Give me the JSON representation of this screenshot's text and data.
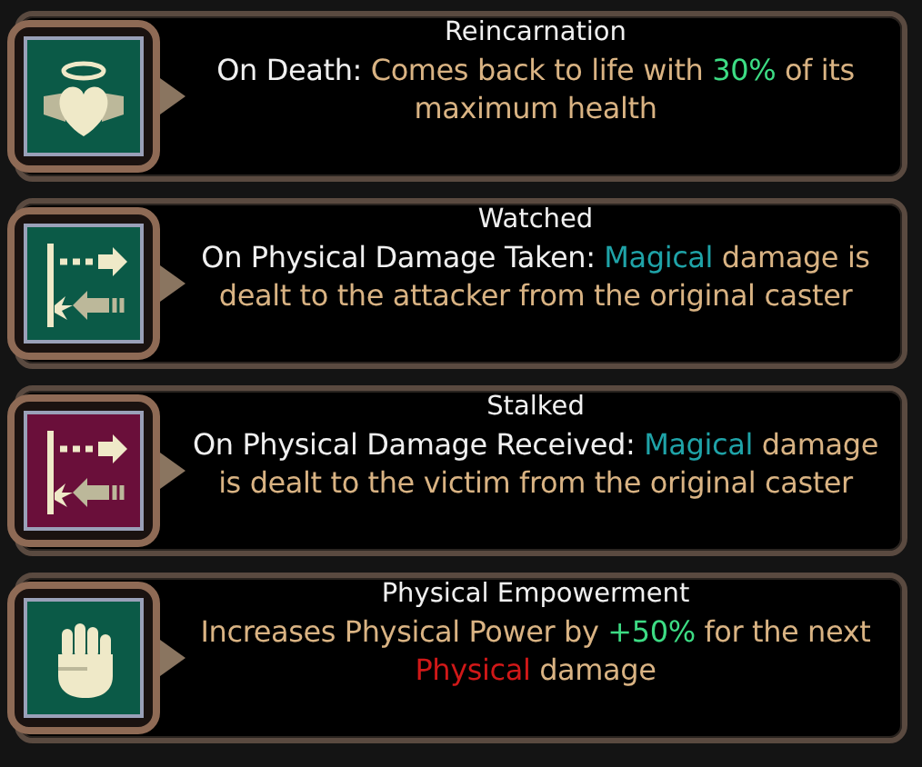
{
  "effects": [
    {
      "title": "Reincarnation",
      "kind": "heart",
      "color": "#0b5a47",
      "description": [
        {
          "kind": "trigger",
          "text": "On Death: "
        },
        {
          "kind": "plain",
          "text": "Comes back to life with "
        },
        {
          "kind": "bonus",
          "text": "30%"
        },
        {
          "kind": "plain",
          "text": " of its maximum health"
        }
      ]
    },
    {
      "title": "Watched",
      "kind": "arrows",
      "color": "#0b5a47",
      "description": [
        {
          "kind": "trigger",
          "text": "On Physical Damage Taken: "
        },
        {
          "kind": "magical",
          "text": "Magical"
        },
        {
          "kind": "plain",
          "text": " damage is dealt to the attacker from the original caster"
        }
      ]
    },
    {
      "title": "Stalked",
      "kind": "arrows",
      "color": "#6a0f3a",
      "description": [
        {
          "kind": "trigger",
          "text": "On Physical Damage Received: "
        },
        {
          "kind": "magical",
          "text": "Magical"
        },
        {
          "kind": "plain",
          "text": " damage is dealt to the victim from the original caster"
        }
      ]
    },
    {
      "title": "Physical Empowerment",
      "kind": "fist",
      "color": "#0b5a47",
      "description": [
        {
          "kind": "plain",
          "text": "Increases Physical Power by "
        },
        {
          "kind": "bonus",
          "text": "+50%"
        },
        {
          "kind": "plain",
          "text": " for the next "
        },
        {
          "kind": "physical",
          "text": "Physical"
        },
        {
          "kind": "plain",
          "text": " damage"
        }
      ]
    }
  ]
}
